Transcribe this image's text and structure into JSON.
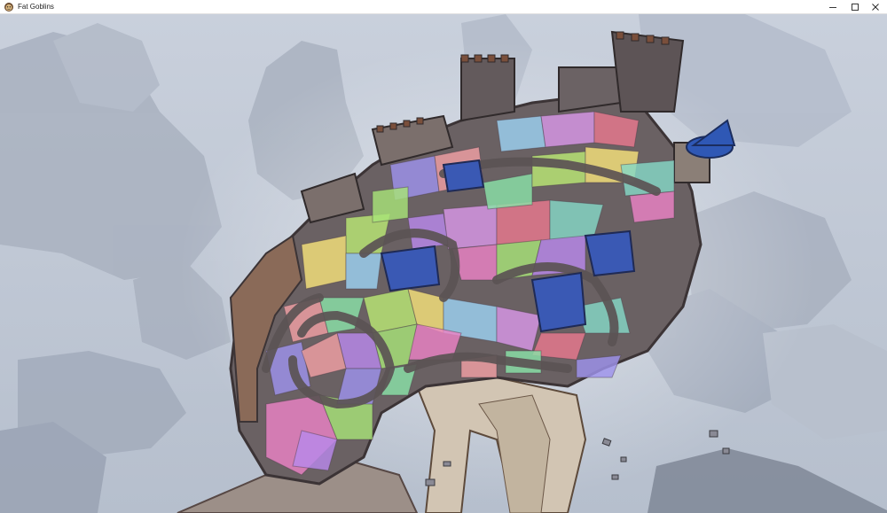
{
  "window": {
    "title": "Fat Goblins",
    "app_icon": "goblin-face-icon",
    "controls": {
      "minimize_icon": "minimize-icon",
      "maximize_icon": "maximize-icon",
      "close_icon": "close-icon"
    }
  },
  "scene": {
    "description_colors": {
      "sky": "#c3cad8",
      "fog_rock": "#aab3c2",
      "castle_wall": "#6f6668",
      "bridge": "#c8bba9",
      "tower_roof": "#2f58b5"
    },
    "region_palette": [
      "#ea82c4",
      "#a7e378",
      "#b889ea",
      "#9d93ec",
      "#f0a0a4",
      "#8ae2a7",
      "#b9e874",
      "#f5e27a",
      "#9cd2f2",
      "#d897e6",
      "#e8798e",
      "#85d8c6"
    ]
  }
}
